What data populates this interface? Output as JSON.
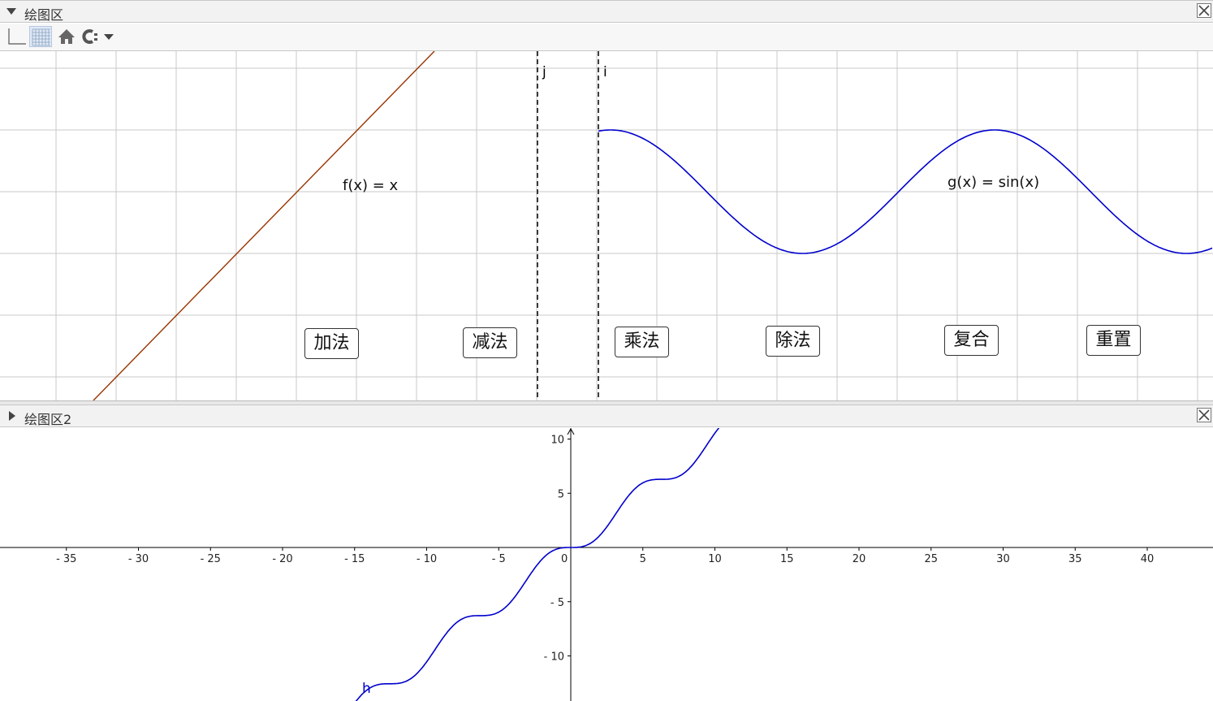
{
  "panel1": {
    "title": "绘图区",
    "functions": [
      {
        "label": "f(x)  =  x",
        "color": "#993300"
      },
      {
        "label": "g(x)  =  sin(x)",
        "color": "#0000cc"
      }
    ],
    "lines": [
      {
        "label": "j"
      },
      {
        "label": "i"
      }
    ],
    "buttons": [
      "加法",
      "减法",
      "乘法",
      "除法",
      "复合",
      "重置"
    ],
    "toolbar": [
      "axes-toggle",
      "grid-toggle",
      "home-icon",
      "magnet-icon"
    ]
  },
  "panel2": {
    "title": "绘图区2",
    "curve_label": "h",
    "curve_color": "#0000cc",
    "x_ticks": [
      "- 35",
      "- 30",
      "- 25",
      "- 20",
      "- 15",
      "- 10",
      "- 5",
      "0",
      "5",
      "10",
      "15",
      "20",
      "25",
      "30",
      "35",
      "40"
    ],
    "y_ticks": [
      "10",
      "5",
      "- 5",
      "- 10"
    ]
  }
}
